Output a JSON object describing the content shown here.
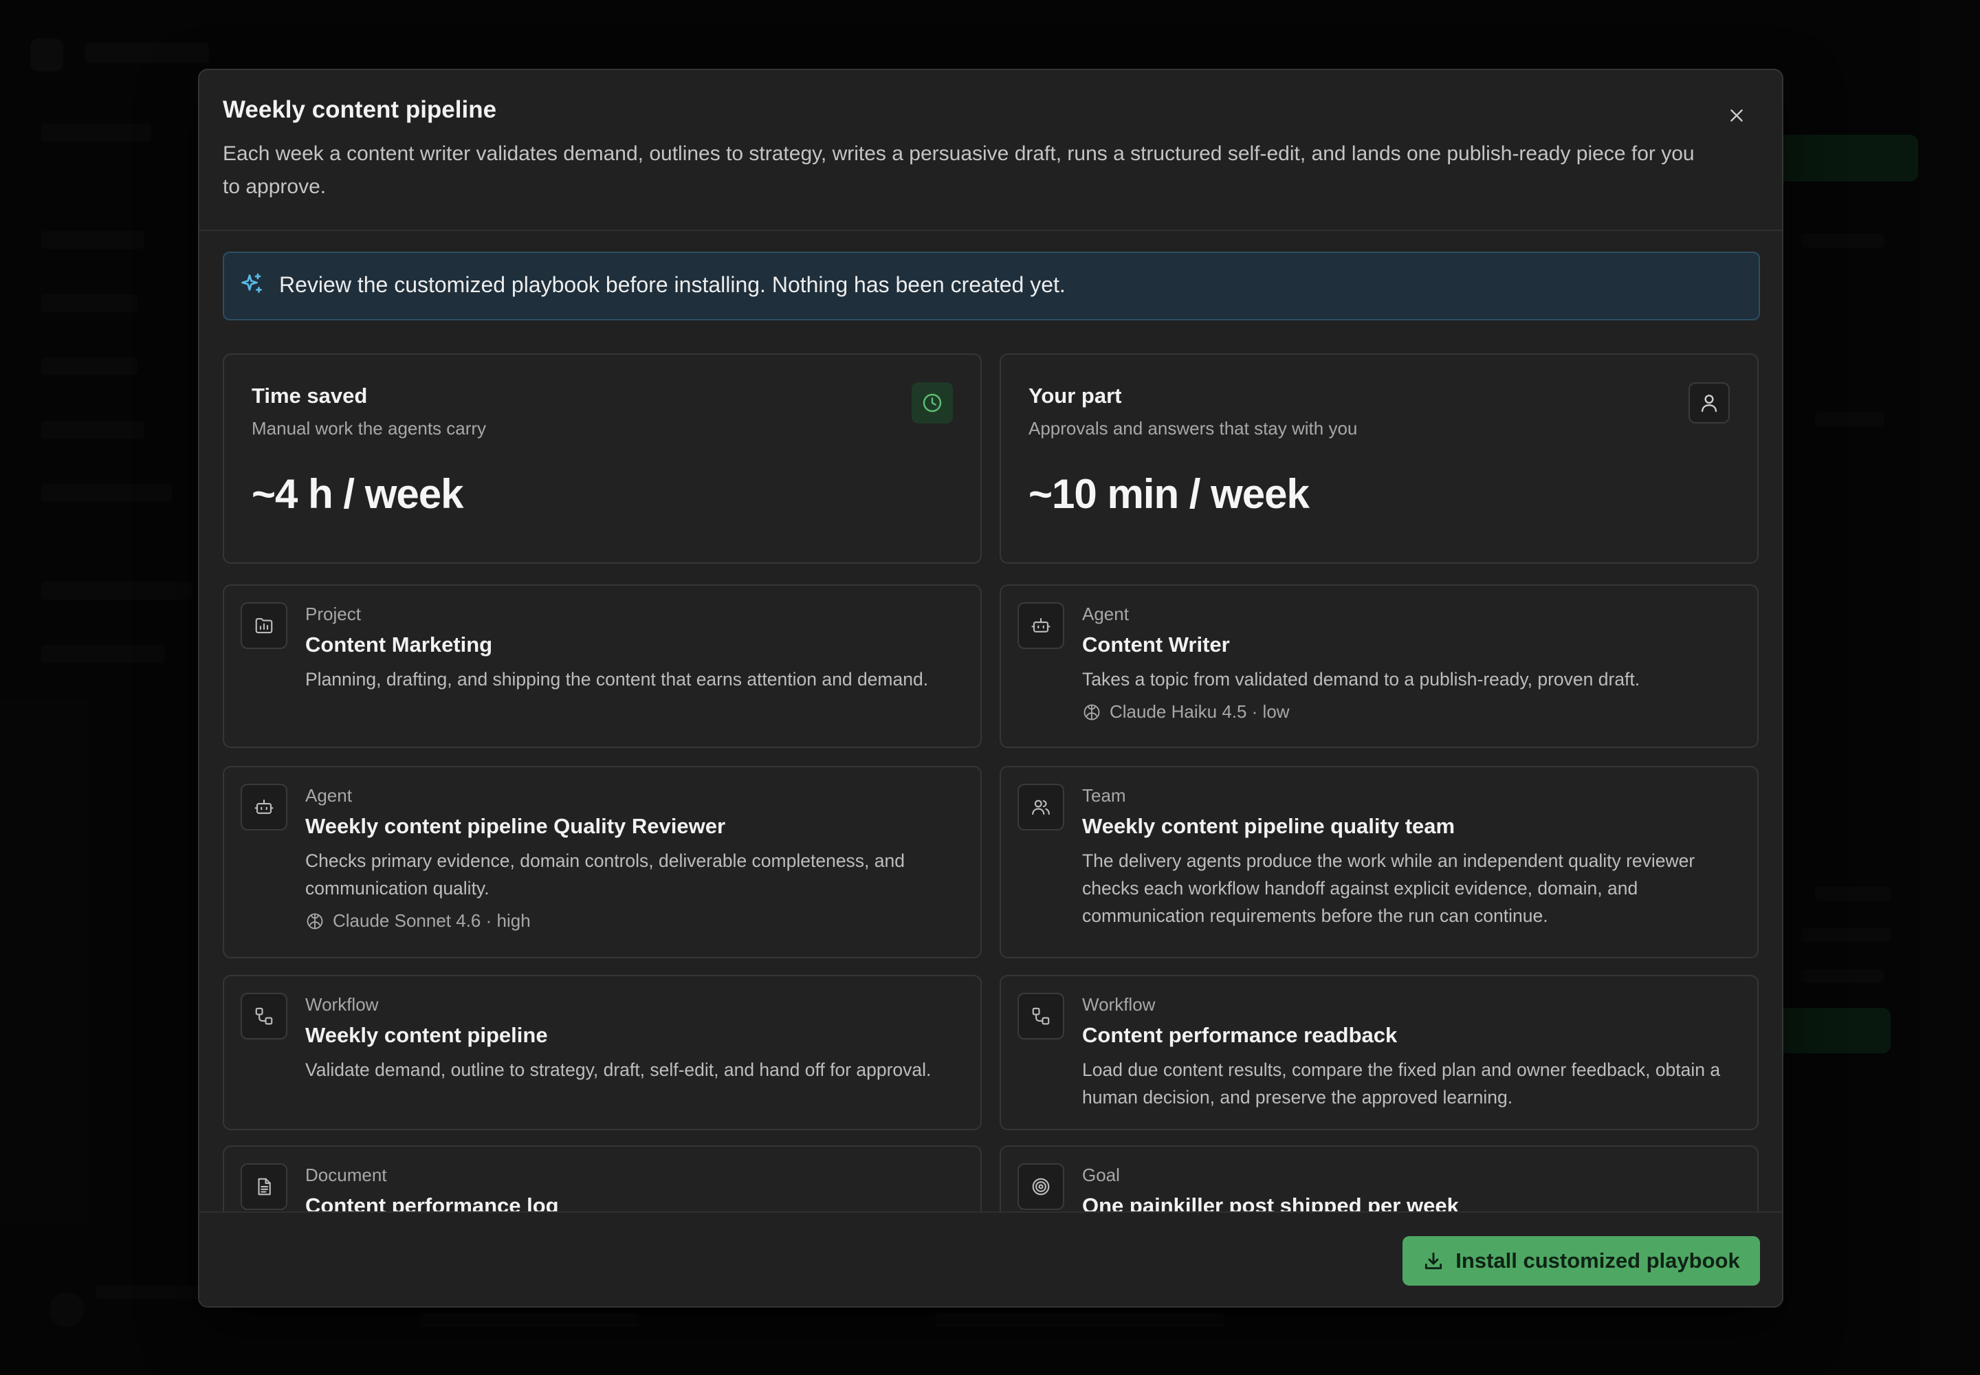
{
  "modal": {
    "title": "Weekly content pipeline",
    "description": "Each week a content writer validates demand, outlines to strategy, writes a persuasive draft, runs a structured self-edit, and lands one publish-ready piece for you to approve.",
    "close_icon": "close-icon"
  },
  "notice": {
    "icon": "sparkles-icon",
    "text": "Review the customized playbook before installing. Nothing has been created yet."
  },
  "stats": [
    {
      "title": "Time saved",
      "subtitle": "Manual work the agents carry",
      "value": "~4 h / week",
      "icon": "clock-icon"
    },
    {
      "title": "Your part",
      "subtitle": "Approvals and answers that stay with you",
      "value": "~10 min / week",
      "icon": "user-icon"
    }
  ],
  "items": [
    {
      "type": "Project",
      "name": "Content Marketing",
      "description": "Planning, drafting, and shipping the content that earns attention and demand.",
      "icon": "folder-chart-icon"
    },
    {
      "type": "Agent",
      "name": "Content Writer",
      "description": "Takes a topic from validated demand to a publish-ready, proven draft.",
      "meta": "Claude Haiku 4.5 · low",
      "icon": "bot-icon"
    },
    {
      "type": "Agent",
      "name": "Weekly content pipeline Quality Reviewer",
      "description": "Checks primary evidence, domain controls, deliverable completeness, and communication quality.",
      "meta": "Claude Sonnet 4.6 · high",
      "icon": "bot-icon"
    },
    {
      "type": "Team",
      "name": "Weekly content pipeline quality team",
      "description": "The delivery agents produce the work while an independent quality reviewer checks each workflow handoff against explicit evidence, domain, and communication requirements before the run can continue.",
      "icon": "users-icon"
    },
    {
      "type": "Workflow",
      "name": "Weekly content pipeline",
      "description": "Validate demand, outline to strategy, draft, self-edit, and hand off for approval.",
      "icon": "workflow-icon"
    },
    {
      "type": "Workflow",
      "name": "Content performance readback",
      "description": "Load due content results, compare the fixed plan and owner feedback, obtain a human decision, and preserve the approved learning.",
      "icon": "workflow-icon"
    },
    {
      "type": "Document",
      "name": "Content performance log",
      "icon": "document-icon"
    },
    {
      "type": "Goal",
      "name": "One painkiller post shipped per week",
      "icon": "target-icon"
    }
  ],
  "footer": {
    "install_label": "Install customized playbook",
    "install_icon": "download-icon"
  },
  "colors": {
    "accent": "#4ea863",
    "notice_bg": "#1f2f3b",
    "notice_border": "#2c4e63",
    "clock_icon": "#5cbf74",
    "sparkles_icon": "#5bb8e8"
  }
}
